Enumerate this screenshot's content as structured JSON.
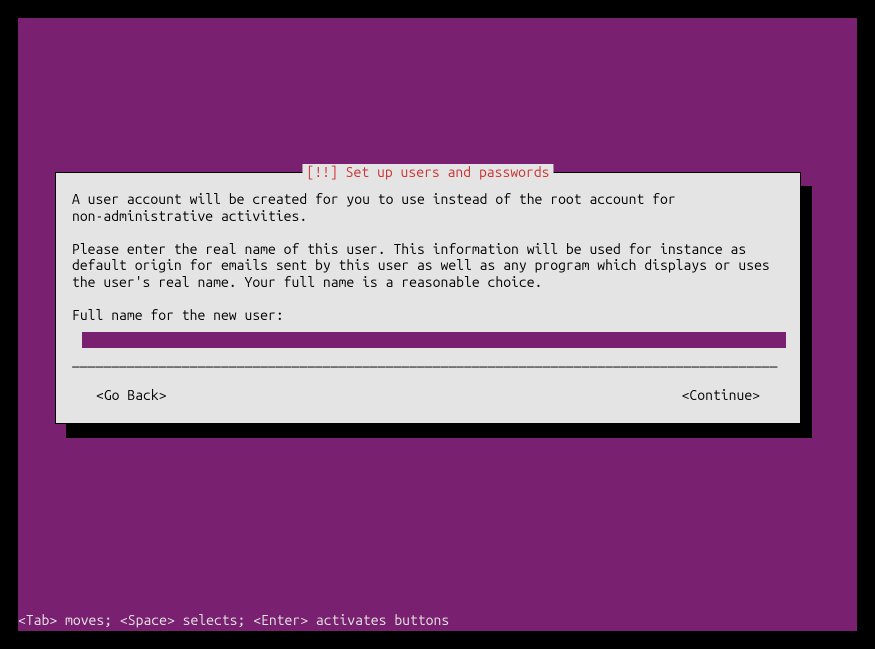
{
  "dialog": {
    "title": "[!!] Set up users and passwords",
    "paragraph1": "A user account will be created for you to use instead of the root account for\nnon-administrative activities.",
    "paragraph2": "Please enter the real name of this user. This information will be used for instance as\ndefault origin for emails sent by this user as well as any program which displays or uses\nthe user's real name. Your full name is a reasonable choice.",
    "prompt": "Full name for the new user:",
    "input_value": "",
    "underline": "__________________________________________________________________________________________",
    "go_back": "<Go Back>",
    "continue": "<Continue>"
  },
  "help_bar": "<Tab> moves; <Space> selects; <Enter> activates buttons"
}
